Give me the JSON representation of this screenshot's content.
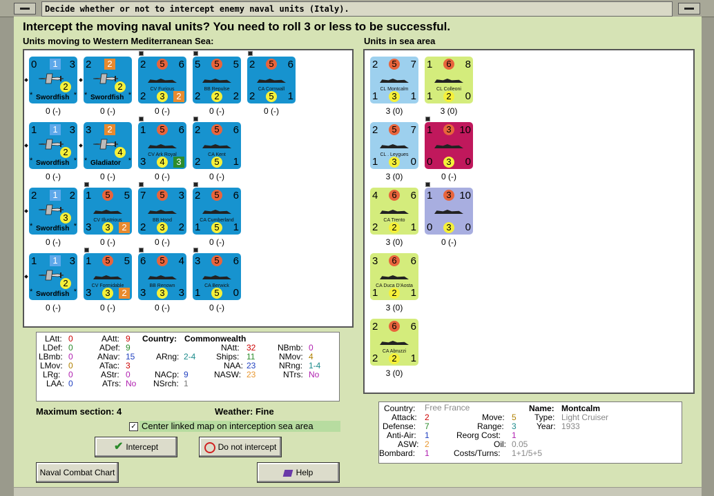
{
  "window": {
    "title": "Decide whether or not to intercept enemy naval units (Italy)."
  },
  "header": {
    "question": "Intercept the moving naval units?  You need to roll 3 or less to be successful."
  },
  "moving": {
    "title": "Units moving to Western Mediterranean Sea:",
    "units": [
      {
        "kind": "air",
        "tl": "0",
        "tr": "3",
        "sq": "1",
        "sqc": "blue",
        "bc": "2",
        "name": "Swordfish",
        "count": "0 (-)"
      },
      {
        "kind": "air",
        "tl": "2",
        "tr": "",
        "sq": "2",
        "sqc": "orange",
        "bc": "2",
        "name": "Swordfish",
        "count": "0 (-)"
      },
      {
        "kind": "ship",
        "tl": "2",
        "tc": "5",
        "tr": "6",
        "bl": "2",
        "bc": "3",
        "br": "2",
        "brsq": "orange",
        "name": "CV Furious",
        "count": "0 (-)"
      },
      {
        "kind": "ship",
        "tl": "5",
        "tc": "5",
        "tr": "5",
        "bl": "2",
        "bc": "2",
        "br": "2",
        "name": "BB Repulse",
        "count": "0 (-)"
      },
      {
        "kind": "ship",
        "tl": "2",
        "tc": "5",
        "tr": "6",
        "bl": "2",
        "bc": "5",
        "br": "1",
        "name": "CA Cornwall",
        "count": "0 (-)"
      },
      {
        "kind": "air",
        "tl": "1",
        "tr": "3",
        "sq": "1",
        "sqc": "blue",
        "bc": "2",
        "name": "Swordfish",
        "count": "0 (-)"
      },
      {
        "kind": "air",
        "tl": "3",
        "tr": "",
        "sq": "2",
        "sqc": "orange",
        "bc": "4",
        "name": "Gladiator",
        "count": "0 (-)"
      },
      {
        "kind": "ship",
        "tl": "1",
        "tc": "5",
        "tr": "6",
        "bl": "3",
        "bc": "4",
        "br": "3",
        "brsq": "green",
        "name": "CV Ark Royal",
        "count": "0 (-)"
      },
      {
        "kind": "ship",
        "tl": "2",
        "tc": "5",
        "tr": "6",
        "bl": "2",
        "bc": "5",
        "br": "1",
        "name": "CA Kent",
        "count": "0 (-)"
      },
      {
        "kind": "air",
        "tl": "2",
        "tr": "2",
        "sq": "1",
        "sqc": "blue",
        "bc": "3",
        "name": "Swordfish",
        "count": "0 (-)"
      },
      {
        "kind": "ship",
        "tl": "1",
        "tc": "5",
        "tr": "5",
        "bl": "3",
        "bc": "3",
        "br": "2",
        "brsq": "orange",
        "name": "CV Illustrious",
        "count": "0 (-)"
      },
      {
        "kind": "ship",
        "tl": "7",
        "tc": "5",
        "tr": "3",
        "bl": "2",
        "bc": "3",
        "br": "2",
        "name": "BB Hood",
        "count": "0 (-)"
      },
      {
        "kind": "ship",
        "tl": "2",
        "tc": "5",
        "tr": "6",
        "bl": "1",
        "bc": "5",
        "br": "1",
        "name": "CA Cumberland",
        "count": "0 (-)"
      },
      {
        "kind": "air",
        "tl": "1",
        "tr": "3",
        "sq": "1",
        "sqc": "blue",
        "bc": "2",
        "name": "Swordfish",
        "count": "0 (-)"
      },
      {
        "kind": "ship",
        "tl": "1",
        "tc": "5",
        "tr": "5",
        "bl": "3",
        "bc": "3",
        "br": "2",
        "brsq": "orange",
        "name": "CV Formidable",
        "count": "0 (-)"
      },
      {
        "kind": "ship",
        "tl": "6",
        "tc": "5",
        "tr": "4",
        "bl": "3",
        "bc": "3",
        "br": "3",
        "name": "BB Renown",
        "count": "0 (-)"
      },
      {
        "kind": "ship",
        "tl": "3",
        "tc": "5",
        "tr": "6",
        "bl": "1",
        "bc": "5",
        "br": "0",
        "name": "CA Berwick",
        "count": "0 (-)"
      }
    ]
  },
  "sea": {
    "title": "Units in sea area",
    "units": [
      {
        "color": "lblue",
        "tl": "2",
        "tc": "5",
        "tr": "7",
        "bl": "1",
        "bc": "3",
        "br": "1",
        "name": "CL Montcalm",
        "count": "3 (0)"
      },
      {
        "color": "lime",
        "tl": "1",
        "tc": "6",
        "tr": "8",
        "bl": "1",
        "bc": "2",
        "br": "0",
        "name": "CL Colleoni",
        "count": "3 (0)"
      },
      {
        "color": "lblue",
        "tl": "2",
        "tc": "5",
        "tr": "7",
        "bl": "1",
        "bc": "3",
        "br": "0",
        "name": "CL . Leygues",
        "count": "3 (0)"
      },
      {
        "color": "magenta",
        "tl": "1",
        "tc": "3",
        "tr": "10",
        "bl": "0",
        "bc": "3",
        "br": "0",
        "name": "",
        "count": "0 (-)"
      },
      {
        "color": "lime",
        "tl": "4",
        "tc": "6",
        "tr": "6",
        "bl": "2",
        "bc": "2",
        "br": "1",
        "name": "CA Trento",
        "count": "3 (0)"
      },
      {
        "color": "lav",
        "tl": "1",
        "tc": "3",
        "tr": "10",
        "bl": "0",
        "bc": "3",
        "br": "0",
        "name": "",
        "count": "0 (-)"
      },
      {
        "color": "lime",
        "tl": "3",
        "tc": "6",
        "tr": "6",
        "bl": "1",
        "bc": "2",
        "br": "1",
        "name": "CA Duca D'Aosta",
        "count": "3 (0)"
      },
      {
        "color": "lime",
        "tl": "2",
        "tc": "6",
        "tr": "6",
        "bl": "2",
        "bc": "2",
        "br": "1",
        "name": "CA Abruzzi",
        "count": "3 (0)"
      }
    ]
  },
  "left_stats": {
    "latt": "LAtt:",
    "latt_v": "0",
    "ldef": "LDef:",
    "ldef_v": "0",
    "lbmb": "LBmb:",
    "lbmb_v": "0",
    "lmov": "LMov:",
    "lmov_v": "0",
    "lrg": "LRg:",
    "lrg_v": "0",
    "laa": "LAA:",
    "laa_v": "0",
    "aatt": "AAtt:",
    "aatt_v": "9",
    "adef": "ADef:",
    "adef_v": "9",
    "anav": "ANav:",
    "anav_v": "15",
    "atac": "ATac:",
    "atac_v": "3",
    "astr": "AStr:",
    "astr_v": "0",
    "atrs": "ATrs:",
    "atrs_v": "No",
    "country_label": "Country:",
    "country": "Commonwealth",
    "arng": "ARng:",
    "arng_v": "2-4",
    "nacp": "NACp:",
    "nacp_v": "9",
    "nsrch": "NSrch:",
    "nsrch_v": "1",
    "natt": "NAtt:",
    "natt_v": "32",
    "ships": "Ships:",
    "ships_v": "11",
    "naa": "NAA:",
    "naa_v": "23",
    "nasw": "NASW:",
    "nasw_v": "23",
    "nbmb": "NBmb:",
    "nbmb_v": "0",
    "nmov": "NMov:",
    "nmov_v": "4",
    "nrng": "NRng:",
    "nrng_v": "1-4",
    "ntrs": "NTrs:",
    "ntrs_v": "No"
  },
  "info": {
    "max_section": "Maximum section: 4",
    "weather": "Weather:  Fine",
    "center_label": "Center linked map on interception sea area",
    "center_checked": "✓"
  },
  "buttons": {
    "intercept": "Intercept",
    "no_intercept": "Do not intercept",
    "chart": "Naval Combat Chart",
    "help": "Help"
  },
  "right_stats": {
    "country_label": "Country:",
    "country": "Free France",
    "attack": "Attack:",
    "attack_v": "2",
    "defense": "Defense:",
    "defense_v": "7",
    "antiair": "Anti-Air:",
    "antiair_v": "1",
    "asw": "ASW:",
    "asw_v": "2",
    "bombard": "Bombard:",
    "bombard_v": "1",
    "move": "Move:",
    "move_v": "5",
    "range": "Range:",
    "range_v": "3",
    "reorg": "Reorg Cost:",
    "reorg_v": "1",
    "oil": "Oil:",
    "oil_v": "0.05",
    "costs": "Costs/Turns:",
    "costs_v": "1+1/5+5",
    "name_label": "Name:",
    "name": "Montcalm",
    "type_label": "Type:",
    "type": "Light Cruiser",
    "year_label": "Year:",
    "year": "1933"
  }
}
